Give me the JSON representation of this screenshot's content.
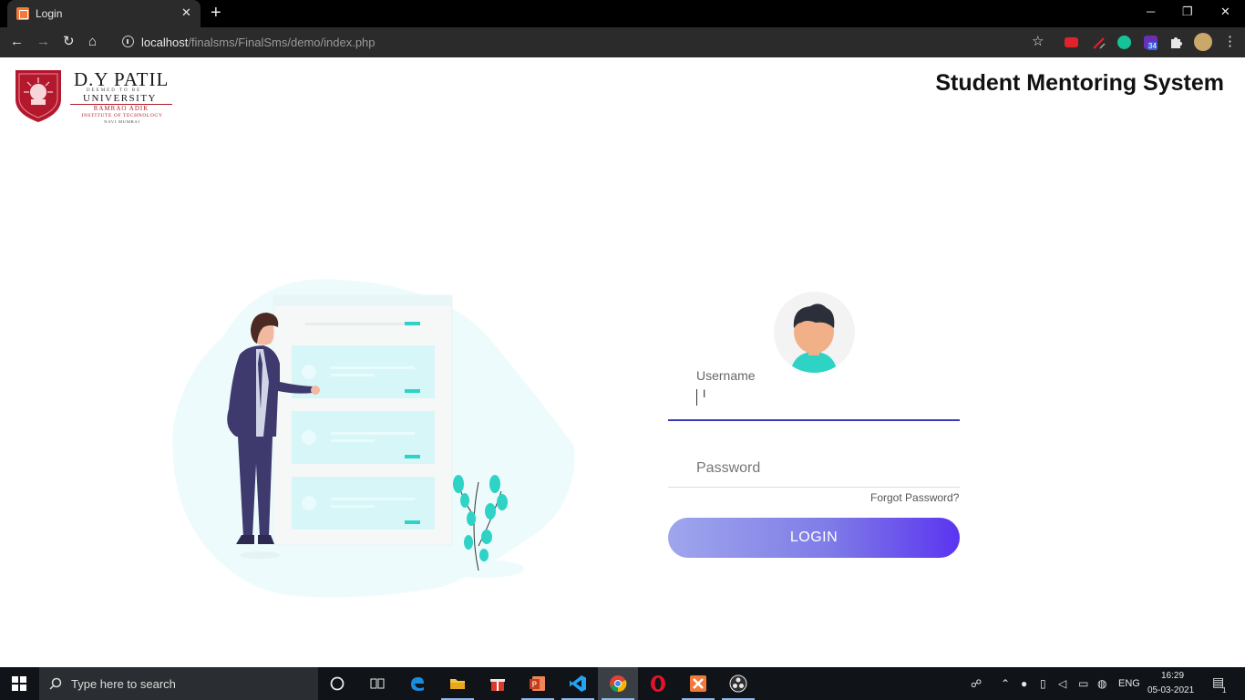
{
  "browser": {
    "tab_title": "Login",
    "tab_close": "✕",
    "new_tab": "+",
    "url_host": "localhost",
    "url_path": "/finalsms/FinalSms/demo/index.php",
    "window_controls": {
      "minimize": "─",
      "maximize": "❐",
      "close": "✕"
    },
    "nav": {
      "back": "←",
      "forward": "→",
      "reload": "↻",
      "home": "⌂"
    },
    "star": "☆",
    "extension_badge": "34"
  },
  "header": {
    "logo": {
      "name": "D.Y PATIL",
      "tagline": "DEEMED TO BE",
      "university": "UNIVERSITY",
      "subtitle": "RAMRAO ADIK",
      "institute": "INSTITUTE OF TECHNOLOGY",
      "city": "NAVI MUMBAI"
    },
    "title": "Student Mentoring System"
  },
  "login_form": {
    "username_label": "Username",
    "username_value": "",
    "password_placeholder": "Password",
    "forgot_password": "Forgot Password?",
    "login_button": "LOGIN"
  },
  "taskbar": {
    "search_placeholder": "Type here to search",
    "language": "ENG",
    "time": "16:29",
    "date": "05-03-2021",
    "notification_count": "1",
    "pinned_apps": [
      "cortana-icon",
      "task-view-icon",
      "edge-icon",
      "file-explorer-icon",
      "gift-app-icon",
      "powerpoint-icon",
      "vscode-icon",
      "chrome-icon",
      "opera-icon",
      "xampp-icon",
      "obs-icon"
    ]
  },
  "colors": {
    "accent": "#5b34f0",
    "input_focus_line": "#3b3bb8",
    "teal": "#2ed3c6",
    "suit": "#3e3a6e"
  }
}
